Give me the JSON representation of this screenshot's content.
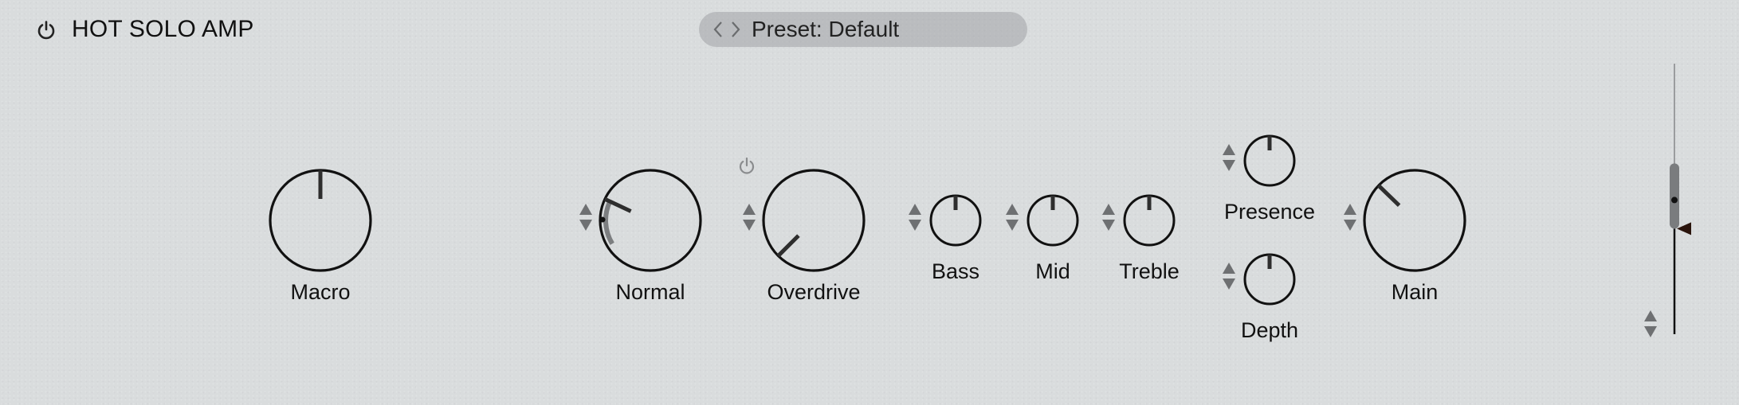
{
  "header": {
    "title": "HOT SOLO AMP",
    "power_icon": "power-icon",
    "power_on": true
  },
  "preset": {
    "label": "Preset: Default",
    "prev_icon": "chevron-left-icon",
    "next_icon": "chevron-right-icon"
  },
  "colors": {
    "background": "#d9dcdd",
    "knob_stroke": "#111111",
    "indicator": "#2e2e2e",
    "mod_arc": "#7c7e80",
    "stepper": "#6e7072",
    "fader_marker": "#2a140c"
  },
  "knobs": [
    {
      "id": "macro",
      "label": "Macro",
      "value": 0.5,
      "stepper": false
    },
    {
      "id": "normal",
      "label": "Normal",
      "value": 0.26,
      "stepper": true,
      "modulation": {
        "from": 0.05,
        "to": 0.26,
        "dot": 0.17
      }
    },
    {
      "id": "overdrive",
      "label": "Overdrive",
      "value": 0.0,
      "stepper": true,
      "power_icon": "power-icon",
      "power_on": false
    },
    {
      "id": "bass",
      "label": "Bass",
      "value": 0.5,
      "stepper": true
    },
    {
      "id": "mid",
      "label": "Mid",
      "value": 0.5,
      "stepper": true
    },
    {
      "id": "treble",
      "label": "Treble",
      "value": 0.5,
      "stepper": true
    },
    {
      "id": "presence",
      "label": "Presence",
      "value": 0.5,
      "stepper": true
    },
    {
      "id": "depth",
      "label": "Depth",
      "value": 0.5,
      "stepper": true
    },
    {
      "id": "main",
      "label": "Main",
      "value": 0.33,
      "stepper": true
    }
  ],
  "output_fader": {
    "level": 0.39,
    "marker": 0.39,
    "stepper": true
  }
}
